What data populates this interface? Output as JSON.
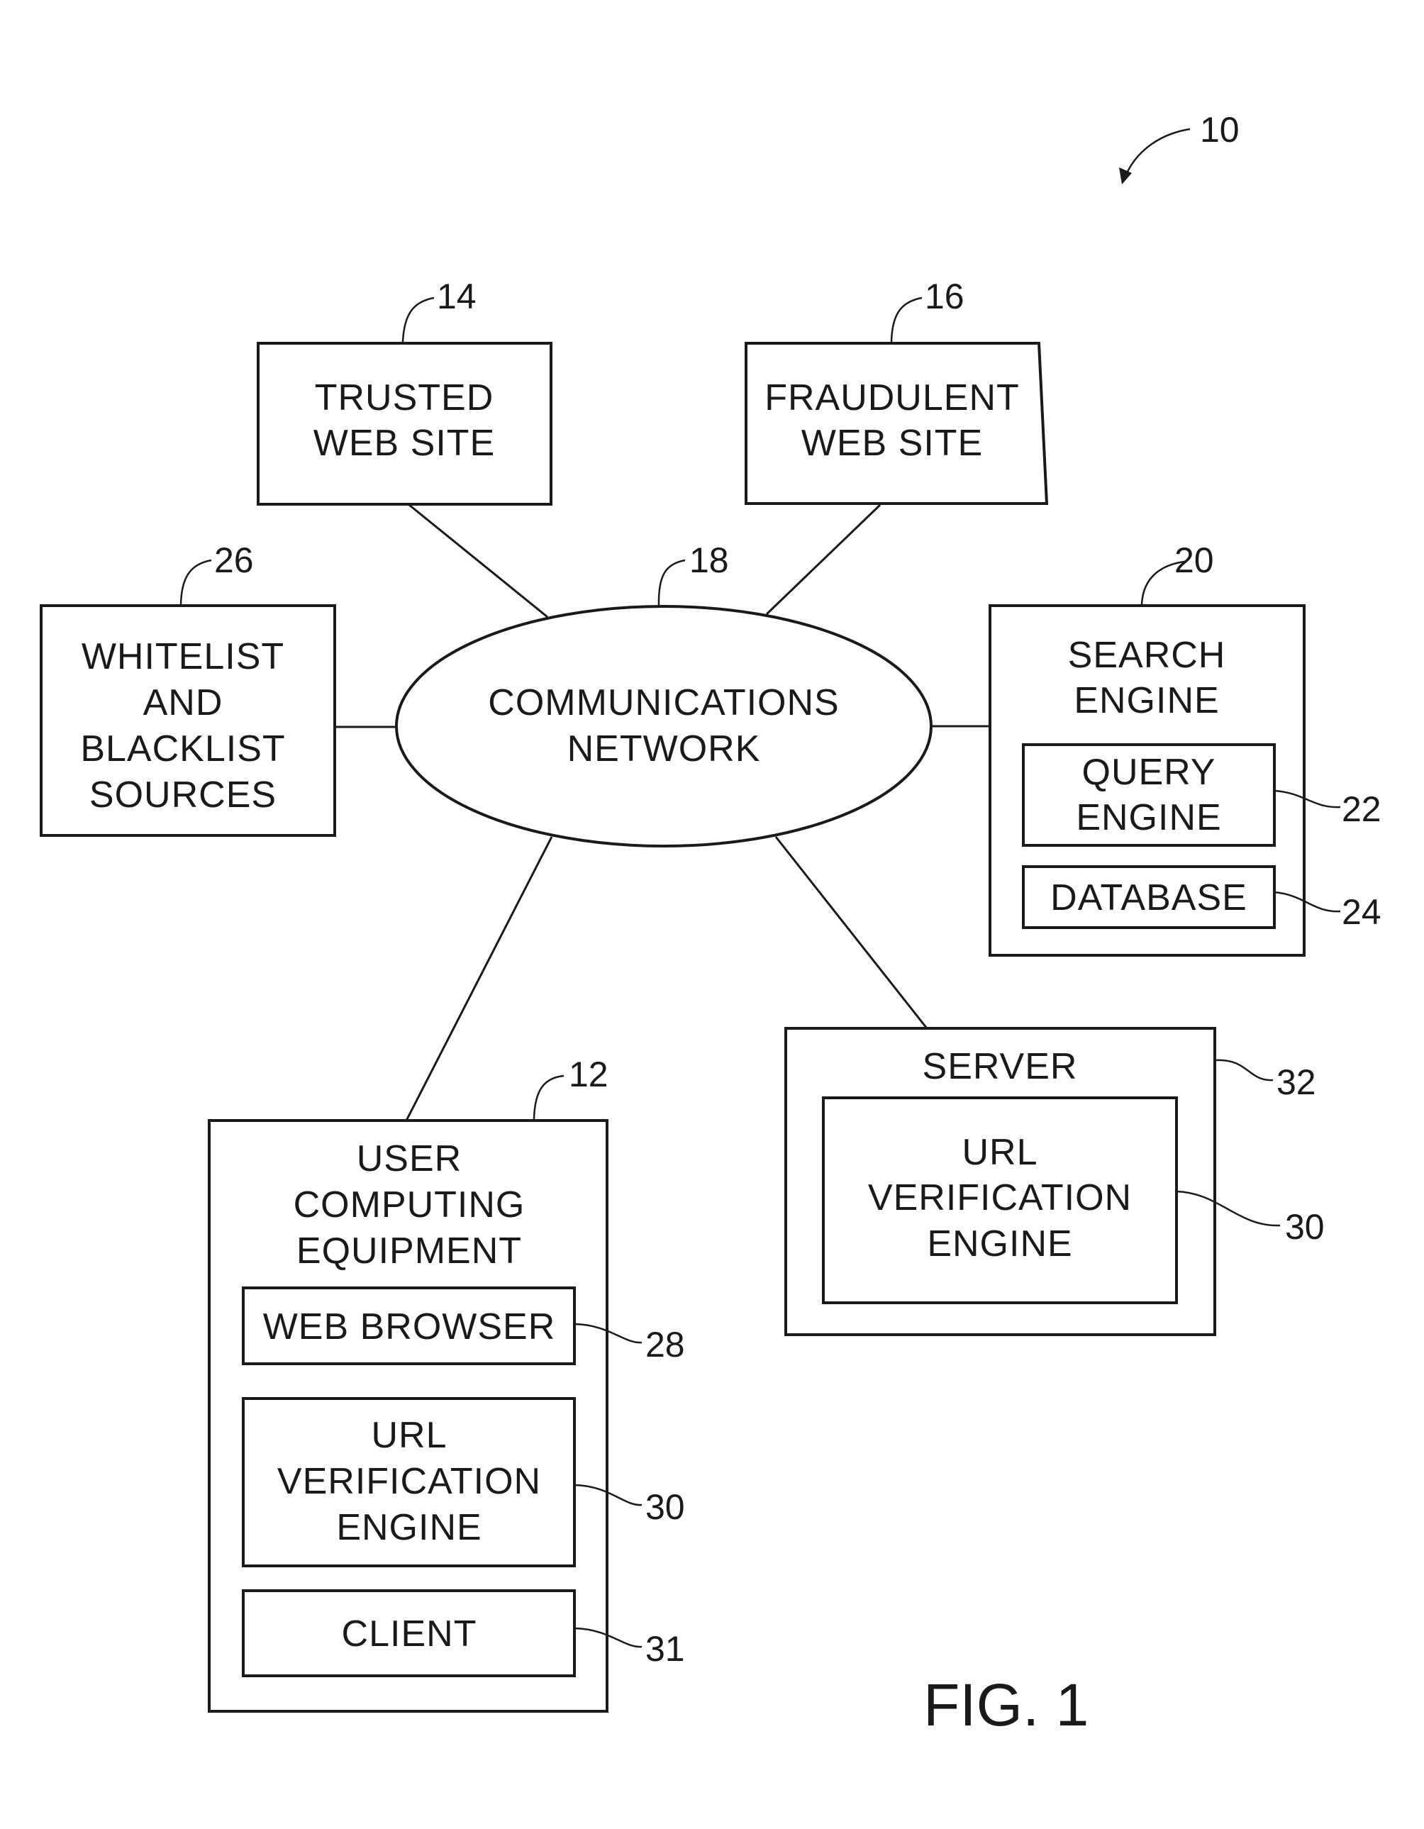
{
  "figure": {
    "title": "FIG. 1",
    "system_ref": "10"
  },
  "network": {
    "ref": "18",
    "lines": [
      "COMMUNICATIONS",
      "NETWORK"
    ]
  },
  "trusted_site": {
    "ref": "14",
    "lines": [
      "TRUSTED",
      "WEB SITE"
    ]
  },
  "fraudulent_site": {
    "ref": "16",
    "lines": [
      "FRAUDULENT",
      "WEB SITE"
    ]
  },
  "lists": {
    "ref": "26",
    "lines": [
      "WHITELIST",
      "AND",
      "BLACKLIST",
      "SOURCES"
    ]
  },
  "search_engine": {
    "ref": "20",
    "lines": [
      "SEARCH",
      "ENGINE"
    ],
    "query_engine": {
      "ref": "22",
      "lines": [
        "QUERY",
        "ENGINE"
      ]
    },
    "database": {
      "ref": "24",
      "lines": [
        "DATABASE"
      ]
    }
  },
  "server": {
    "ref": "32",
    "lines": [
      "SERVER"
    ],
    "url_engine": {
      "ref": "30",
      "lines": [
        "URL",
        "VERIFICATION",
        "ENGINE"
      ]
    }
  },
  "user_equipment": {
    "ref": "12",
    "lines": [
      "USER",
      "COMPUTING",
      "EQUIPMENT"
    ],
    "web_browser": {
      "ref": "28",
      "lines": [
        "WEB BROWSER"
      ]
    },
    "url_engine": {
      "ref": "30",
      "lines": [
        "URL",
        "VERIFICATION",
        "ENGINE"
      ]
    },
    "client": {
      "ref": "31",
      "lines": [
        "CLIENT"
      ]
    }
  }
}
